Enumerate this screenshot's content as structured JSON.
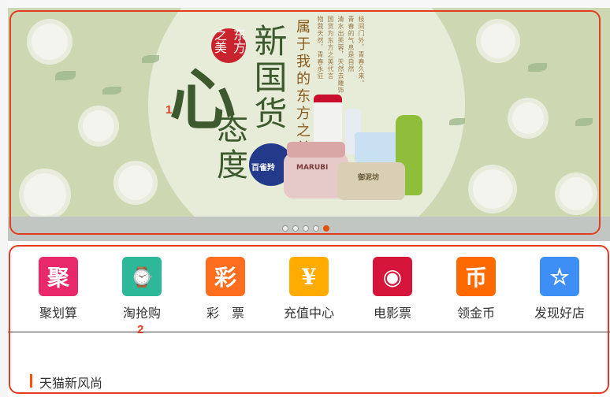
{
  "banner": {
    "seal_text": "东方之美",
    "headline_xin": "心",
    "headline_taidu": "态度",
    "headline_xinguohuo": "新国货",
    "subtitle": "属于我的东方之美",
    "poem_lines": [
      "枝间门外，青春久来。",
      "青春的气息是自然",
      "清水出芙蓉，天然去雕饰",
      "国货为东方之美代言",
      "物我天然，青春永驻"
    ],
    "product_baique": "百雀羚",
    "product_marubi": "MARUBI",
    "product_yuniquan": "御泥坊",
    "active_slide": 5,
    "slide_count": 5
  },
  "annotations": {
    "banner_number": "1",
    "icons_number": "2"
  },
  "icons": [
    {
      "name": "聚划算",
      "glyph": "聚",
      "color": "#e8286b"
    },
    {
      "name": "淘抢购",
      "glyph": "⌚",
      "color": "#2db89a"
    },
    {
      "name": "彩　票",
      "glyph": "彩",
      "color": "#ff6d1f"
    },
    {
      "name": "充值中心",
      "glyph": "¥",
      "color": "#ffab00"
    },
    {
      "name": "电影票",
      "glyph": "◉",
      "color": "#d5163a"
    },
    {
      "name": "领金币",
      "glyph": "币",
      "color": "#ff6a00"
    },
    {
      "name": "发现好店",
      "glyph": "☆",
      "color": "#3d8ff5"
    }
  ],
  "section": {
    "title": "天猫新风尚"
  }
}
